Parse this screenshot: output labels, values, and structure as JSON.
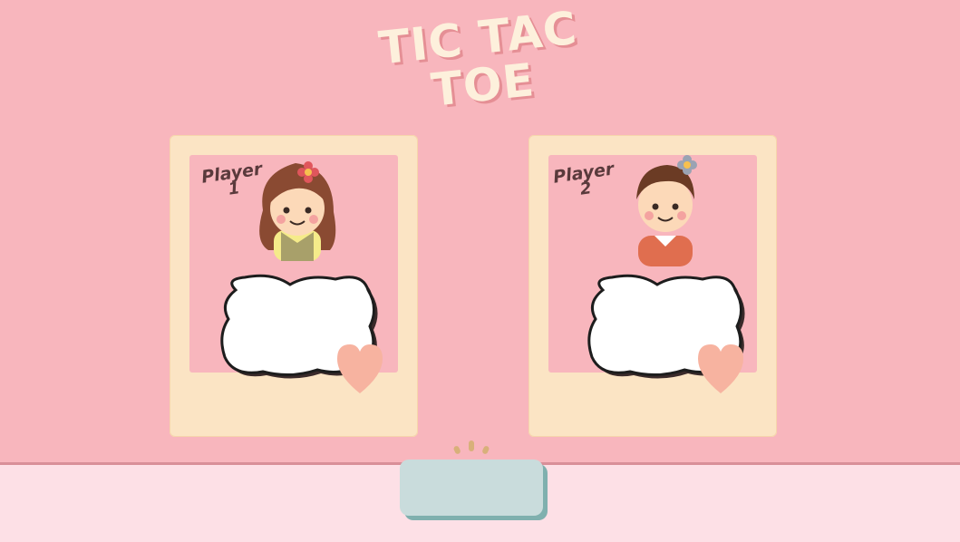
{
  "title": {
    "line1": "TIC TAC",
    "line2": "TOE"
  },
  "players": [
    {
      "label": "Player",
      "number": "1",
      "name_value": "",
      "flower_color": "#e0565c"
    },
    {
      "label": "Player",
      "number": "2",
      "name_value": "",
      "flower_color": "#9aa3b3"
    }
  ],
  "start_button": {
    "label": ""
  },
  "colors": {
    "background": "#f8b6bd",
    "floor": "#fde0e6",
    "frame": "#fbe4c4",
    "title": "#fdf0dc",
    "button": "#c9dcdc",
    "heart": "#f7b3a0"
  }
}
